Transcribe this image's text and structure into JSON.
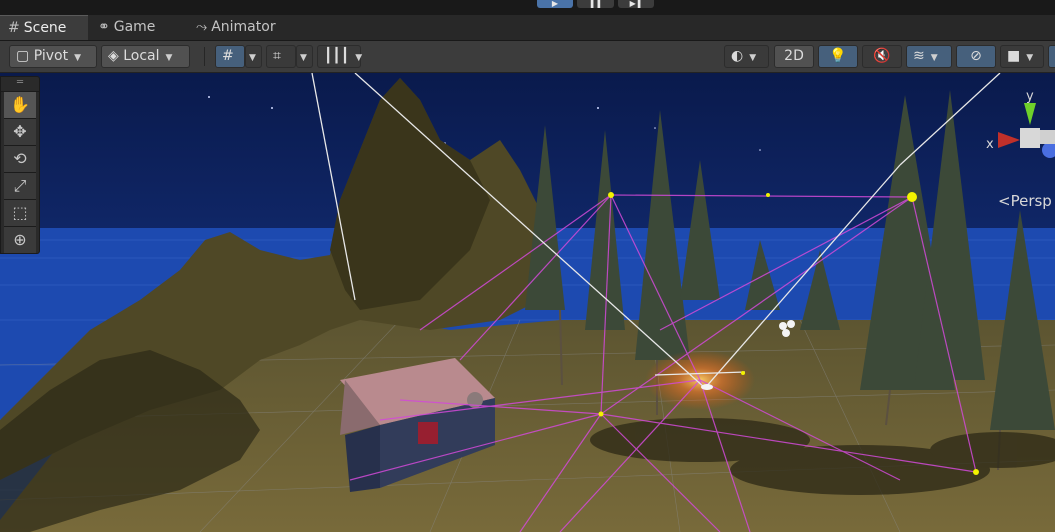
{
  "tabs": [
    {
      "label": "Scene",
      "icon": "grid-icon",
      "active": true
    },
    {
      "label": "Game",
      "icon": "gamepad-icon",
      "active": false
    },
    {
      "label": "Animator",
      "icon": "animator-icon",
      "active": false
    }
  ],
  "toolbar": {
    "pivot_label": "Pivot",
    "local_label": "Local",
    "mode_2d_label": "2D"
  },
  "gizmo": {
    "axis_x": "x",
    "axis_y": "y",
    "projection_label": "Persp"
  },
  "tools": [
    "hand-tool",
    "move-tool",
    "rotate-tool",
    "scale-tool",
    "rect-tool",
    "transform-tool"
  ],
  "colors": {
    "accent_blue": "#46607c",
    "play_active": "#4a73a8",
    "sky": "#0b1e57",
    "ground": "#6b6032",
    "light_line": "#d24ad8"
  }
}
